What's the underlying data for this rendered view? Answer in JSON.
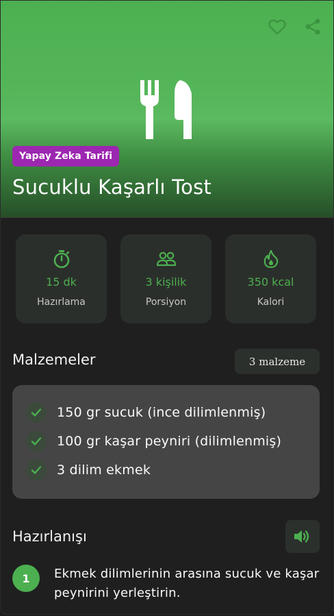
{
  "hero": {
    "badge": "Yapay Zeka Tarifi",
    "title": "Sucuklu Kaşarlı Tost",
    "icons": [
      "heart-icon",
      "share-icon",
      "utensils-icon"
    ]
  },
  "stats": [
    {
      "value": "15 dk",
      "label": "Hazırlama",
      "icon": "timer-icon"
    },
    {
      "value": "3 kişilik",
      "label": "Porsiyon",
      "icon": "people-icon"
    },
    {
      "value": "350 kcal",
      "label": "Kalori",
      "icon": "fire-icon"
    }
  ],
  "ingredients": {
    "title": "Malzemeler",
    "count": "3 malzeme",
    "items": [
      "150 gr sucuk (ince dilimlenmiş)",
      "100 gr kaşar peyniri (dilimlenmiş)",
      "3 dilim ekmek"
    ]
  },
  "preparation": {
    "title": "Hazırlanışı",
    "steps": [
      {
        "number": "1",
        "text": "Ekmek dilimlerinin arasına sucuk ve kaşar peynirini yerleştirin."
      }
    ]
  },
  "colors": {
    "accent": "#4caf50",
    "badge": "#9c27b0",
    "background": "#1f1f1f"
  }
}
